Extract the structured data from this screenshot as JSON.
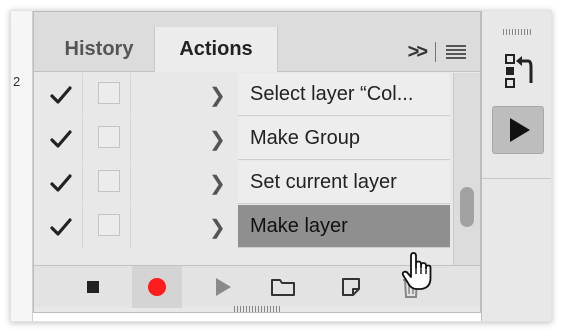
{
  "canvas": {
    "partial_number": "2"
  },
  "tabs": [
    {
      "label": "History",
      "active": false
    },
    {
      "label": "Actions",
      "active": true
    }
  ],
  "panel_tools": {
    "expand_label": ">>"
  },
  "actions_list": [
    {
      "checked": true,
      "label": "Select layer “Col...",
      "selected": false
    },
    {
      "checked": true,
      "label": "Make Group",
      "selected": false
    },
    {
      "checked": true,
      "label": "Set current layer",
      "selected": false
    },
    {
      "checked": true,
      "label": "Make layer",
      "selected": true
    }
  ],
  "toolbar": {
    "buttons": [
      "stop-playing-recording",
      "begin-recording",
      "play-selection",
      "create-new-set",
      "create-new-action",
      "delete"
    ],
    "record_color": "#ff1c1c"
  },
  "colors": {
    "panel_bg": "#e8e8e8",
    "selected_row": "#8f8f8f",
    "record_red": "#ff1c1c"
  }
}
